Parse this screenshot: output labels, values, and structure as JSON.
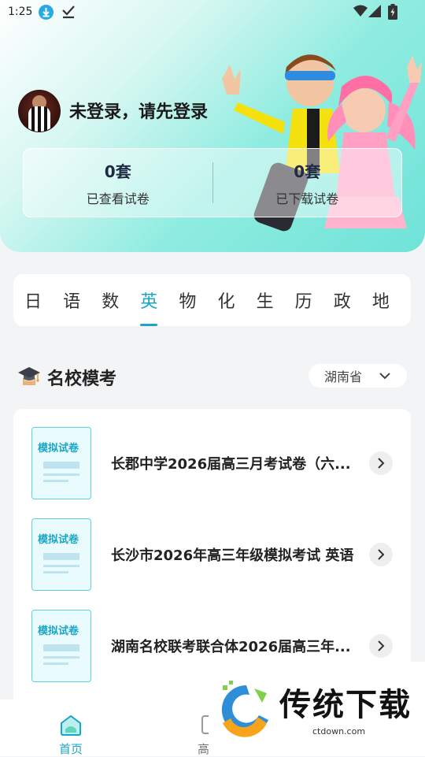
{
  "status_bar": {
    "time": "1:25"
  },
  "profile": {
    "login_prompt": "未登录，请先登录"
  },
  "stats": [
    {
      "value": "0套",
      "label": "已查看试卷"
    },
    {
      "value": "0套",
      "label": "已下载试卷"
    }
  ],
  "subjects": {
    "items": [
      "日",
      "语",
      "数",
      "英",
      "物",
      "化",
      "生",
      "历",
      "政",
      "地"
    ],
    "active": "英"
  },
  "section": {
    "title": "名校模考",
    "region": "湖南省"
  },
  "papers": [
    {
      "thumb_label": "模拟试卷",
      "title": "长郡中学2026届高三月考试卷（六..."
    },
    {
      "thumb_label": "模拟试卷",
      "title": "长沙市2026年高三年级模拟考试 英语"
    },
    {
      "thumb_label": "模拟试卷",
      "title": "湖南名校联考联合体2026届高三年..."
    }
  ],
  "bottom_nav": {
    "home_label": "首页",
    "second_label": "高考"
  },
  "watermark": {
    "text": "传统下载",
    "sub": "ctdown.com"
  },
  "colors": {
    "accent": "#1aa6c6",
    "header_gradient_end": "#6fe3d8"
  }
}
